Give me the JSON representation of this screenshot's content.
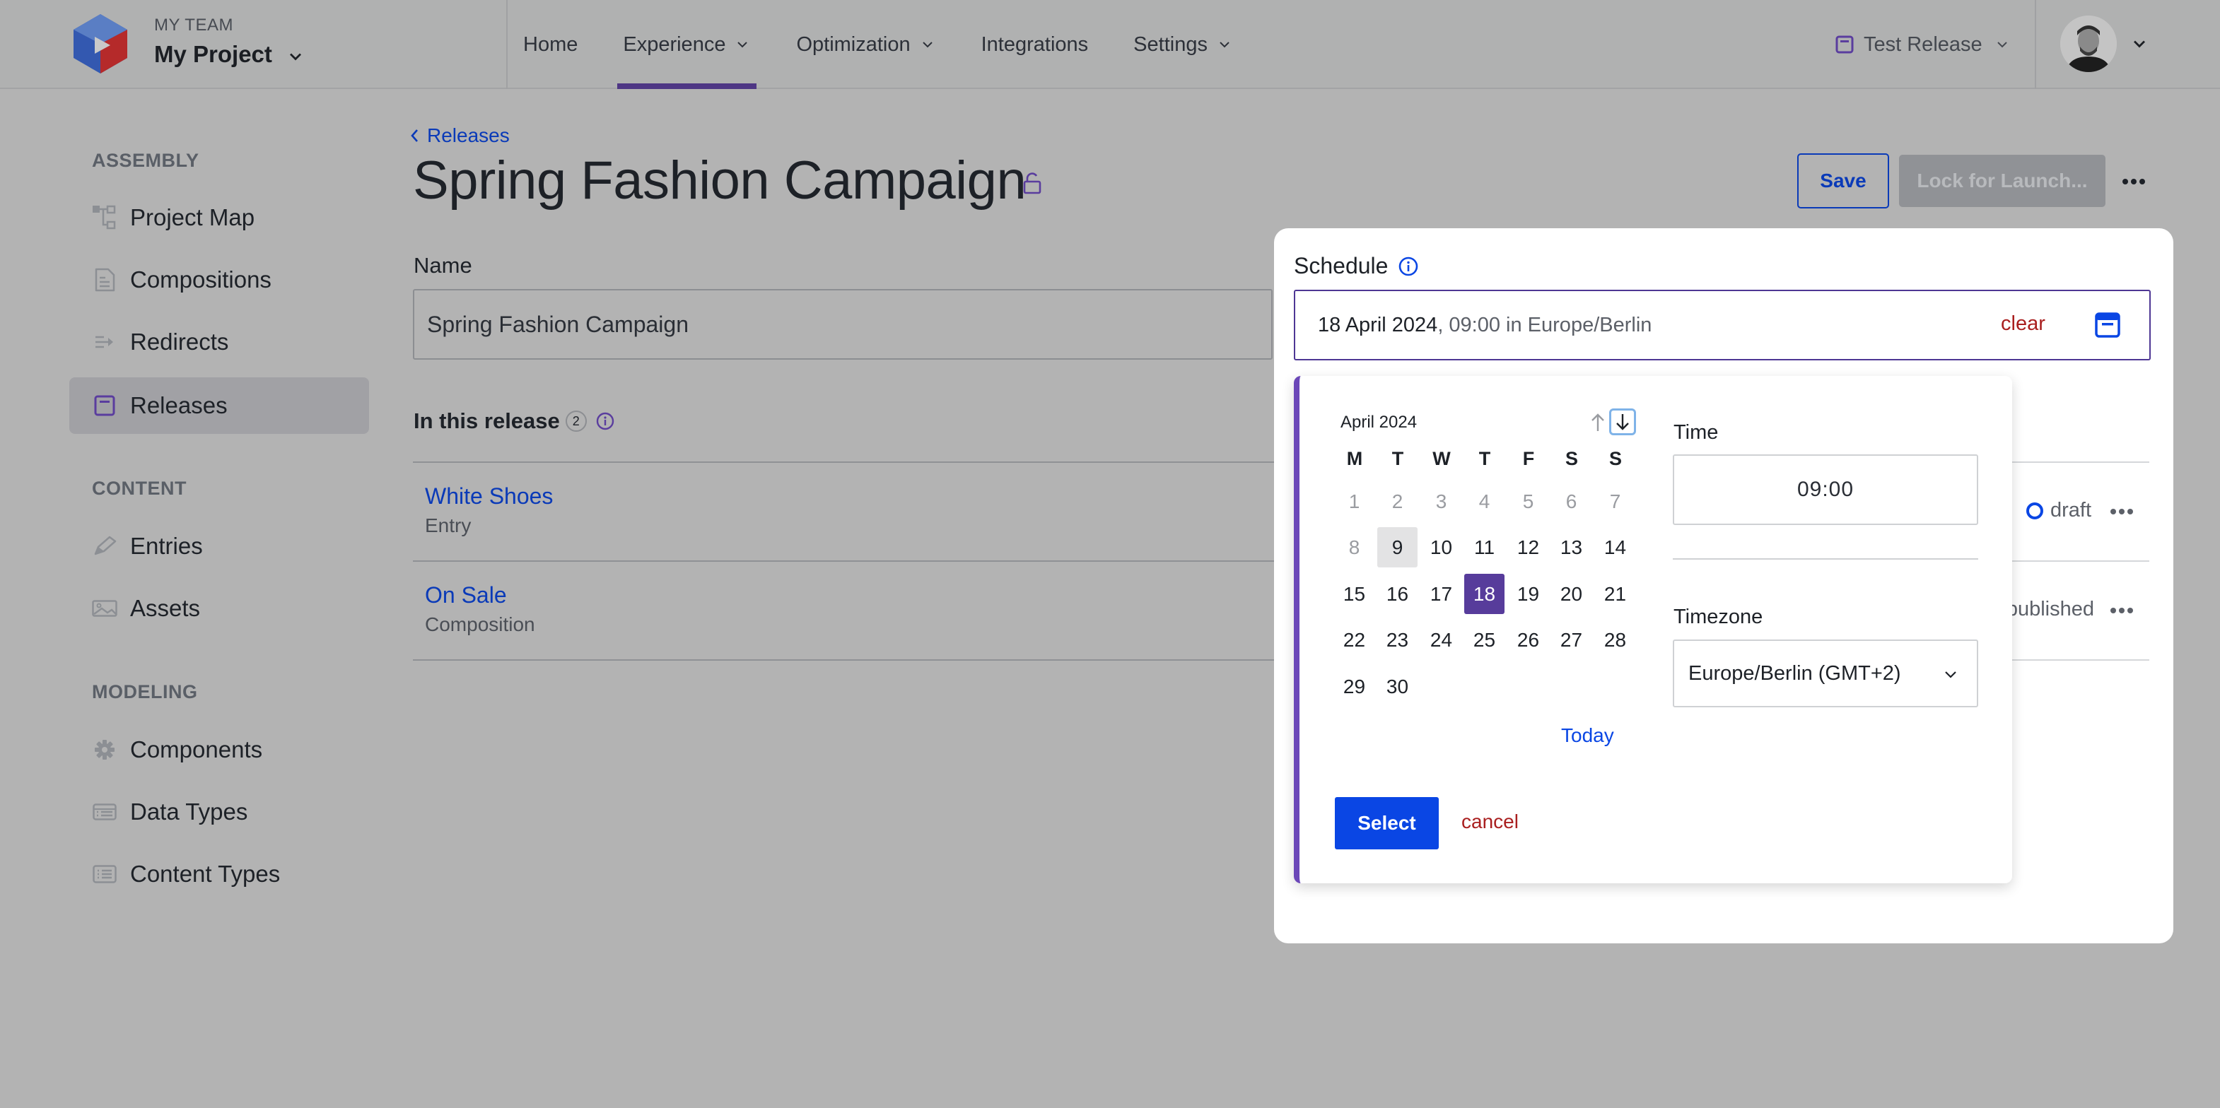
{
  "header": {
    "team_label": "MY TEAM",
    "project_name": "My Project",
    "nav": [
      {
        "label": "Home",
        "has_dropdown": false,
        "active": false
      },
      {
        "label": "Experience",
        "has_dropdown": true,
        "active": true
      },
      {
        "label": "Optimization",
        "has_dropdown": true,
        "active": false
      },
      {
        "label": "Integrations",
        "has_dropdown": false,
        "active": false
      },
      {
        "label": "Settings",
        "has_dropdown": true,
        "active": false
      }
    ],
    "release_picker": {
      "label": "Test Release",
      "icon": "calendar-icon"
    },
    "avatar": {
      "icon": "user-avatar"
    }
  },
  "sidebar": {
    "sections": [
      {
        "title": "ASSEMBLY",
        "items": [
          {
            "label": "Project Map",
            "icon": "sitemap-icon",
            "active": false
          },
          {
            "label": "Compositions",
            "icon": "document-icon",
            "active": false
          },
          {
            "label": "Redirects",
            "icon": "redirect-icon",
            "active": false
          },
          {
            "label": "Releases",
            "icon": "calendar-icon",
            "active": true
          }
        ]
      },
      {
        "title": "CONTENT",
        "items": [
          {
            "label": "Entries",
            "icon": "pencil-icon",
            "active": false
          },
          {
            "label": "Assets",
            "icon": "image-icon",
            "active": false
          }
        ]
      },
      {
        "title": "MODELING",
        "items": [
          {
            "label": "Components",
            "icon": "gear-icon",
            "active": false
          },
          {
            "label": "Data Types",
            "icon": "data-types-icon",
            "active": false
          },
          {
            "label": "Content Types",
            "icon": "list-icon",
            "active": false
          }
        ]
      }
    ]
  },
  "main": {
    "breadcrumb": "Releases",
    "title": "Spring Fashion Campaign",
    "actions": {
      "save": "Save",
      "lock": "Lock for Launch..."
    },
    "name_field": {
      "label": "Name",
      "value": "Spring Fashion Campaign"
    },
    "in_release": {
      "label": "In this release",
      "count": "2"
    },
    "items": [
      {
        "title": "White Shoes",
        "type": "Entry",
        "status": "draft"
      },
      {
        "title": "On Sale",
        "type": "Composition",
        "status": "published"
      }
    ]
  },
  "schedule": {
    "label": "Schedule",
    "value_date": "18 April 2024",
    "value_rest": ", 09:00 in Europe/Berlin",
    "clear_label": "clear",
    "picker": {
      "month_label": "April 2024",
      "weekdays": [
        "M",
        "T",
        "W",
        "T",
        "F",
        "S",
        "S"
      ],
      "days_in_month": 30,
      "first_weekday_index": 0,
      "muted_through_day": 8,
      "today_day": 9,
      "selected_day": 18,
      "today_link": "Today",
      "select_label": "Select",
      "cancel_label": "cancel",
      "time_label": "Time",
      "time_value": "09:00",
      "timezone_label": "Timezone",
      "timezone_value": "Europe/Berlin (GMT+2)"
    }
  },
  "colors": {
    "accent_purple": "#573c9b",
    "link_blue": "#0a3ab8",
    "primary_blue": "#0a46e4",
    "danger_red": "#a91f1f"
  }
}
